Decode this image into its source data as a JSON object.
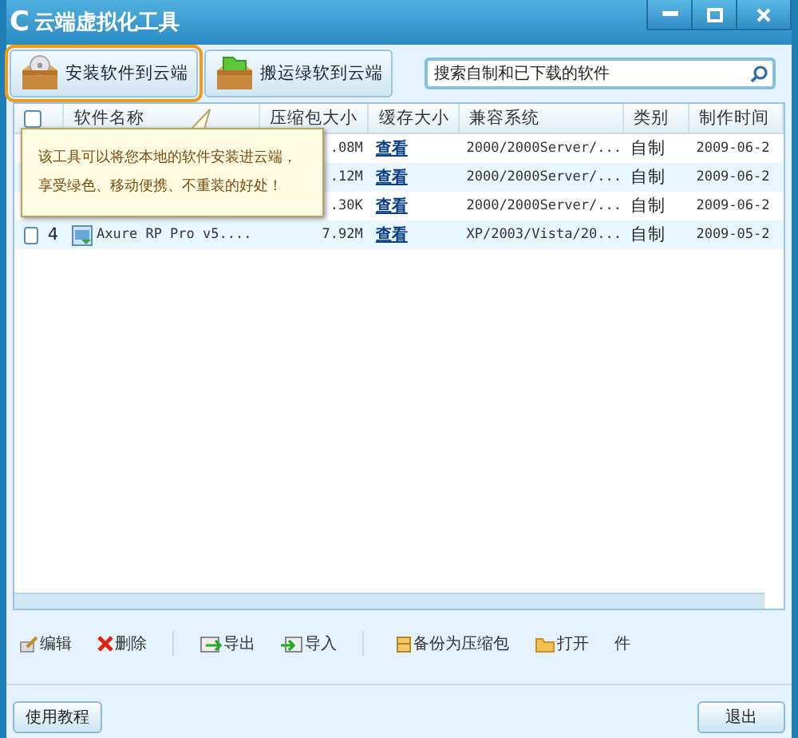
{
  "window": {
    "logo": "C",
    "title": "云端虚拟化工具"
  },
  "toolbar": {
    "buttons": [
      {
        "label": "安装软件到云端",
        "kind": "disc",
        "selected": true
      },
      {
        "label": "搬运绿软到云端",
        "kind": "folder",
        "selected": false
      }
    ],
    "search": {
      "placeholder": "搜索自制和已下载的软件"
    }
  },
  "table": {
    "header_checked": false,
    "columns": [
      "",
      "软件名称",
      "压缩包大小",
      "缓存大小",
      "兼容系统",
      "类别",
      "制作时间"
    ],
    "rows": [
      {
        "size": ".08M",
        "cache": "查看",
        "os": "2000/2000Server/...",
        "category": "自制",
        "date": "2009-06-2"
      },
      {
        "size": ".12M",
        "cache": "查看",
        "os": "2000/2000Server/...",
        "category": "自制",
        "date": "2009-06-2"
      },
      {
        "size": ".30K",
        "cache": "查看",
        "os": "2000/2000Server/...",
        "category": "自制",
        "date": "2009-06-2"
      },
      {
        "checked": false,
        "number": "4",
        "name": "Axure RP Pro v5....",
        "size": "7.92M",
        "cache": "查看",
        "os": "XP/2003/Vista/20...",
        "category": "自制",
        "date": "2009-05-2"
      }
    ]
  },
  "tooltip": {
    "lines": [
      "该工具可以将您本地的软件安装进云端，",
      "享受绿色、移动便携、不重装的好处！"
    ]
  },
  "actions": [
    {
      "label": "编辑",
      "kind": "edit"
    },
    {
      "label": "删除",
      "kind": "delete"
    },
    {
      "kind": "separator"
    },
    {
      "label": "导出",
      "kind": "export"
    },
    {
      "label": "导入",
      "kind": "import"
    },
    {
      "kind": "separator"
    },
    {
      "label": "备份为压缩包",
      "kind": "backup"
    },
    {
      "label": "打开",
      "kind": "open"
    },
    {
      "label": "件",
      "kind": "plain"
    }
  ],
  "footer": {
    "left_button": "使用教程",
    "right_button": "退出"
  }
}
